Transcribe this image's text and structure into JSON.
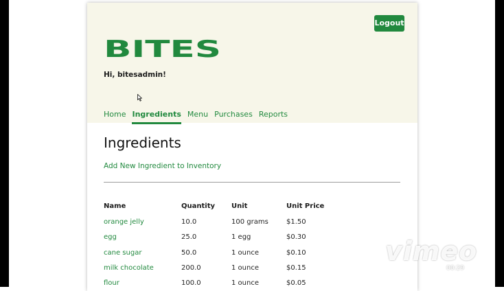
{
  "app": {
    "logout_label": "Logout",
    "logo_text": "BITES",
    "greeting": "Hi, bitesadmin!"
  },
  "nav": [
    {
      "label": "Home",
      "active": false
    },
    {
      "label": "Ingredients",
      "active": true
    },
    {
      "label": "Menu",
      "active": false
    },
    {
      "label": "Purchases",
      "active": false
    },
    {
      "label": "Reports",
      "active": false
    }
  ],
  "main": {
    "title": "Ingredients",
    "add_link": "Add New Ingredient to Inventory"
  },
  "table": {
    "columns": [
      "Name",
      "Quantity",
      "Unit",
      "Unit Price"
    ],
    "rows": [
      {
        "name": "orange jelly",
        "quantity": "10.0",
        "unit": "100 grams",
        "price": "$1.50"
      },
      {
        "name": "egg",
        "quantity": "25.0",
        "unit": "1 egg",
        "price": "$0.30"
      },
      {
        "name": "cane sugar",
        "quantity": "50.0",
        "unit": "1 ounce",
        "price": "$0.10"
      },
      {
        "name": "milk chocolate",
        "quantity": "200.0",
        "unit": "1 ounce",
        "price": "$0.15"
      },
      {
        "name": "flour",
        "quantity": "100.0",
        "unit": "1 ounce",
        "price": "$0.05"
      }
    ]
  },
  "overlay": {
    "watermark": "vimeo",
    "time": "00:29",
    "icons": [
      "pencil-icon",
      "forward-icon",
      "pause-icon",
      "stop-icon",
      "power-icon"
    ]
  },
  "colors": {
    "accent": "#21893e",
    "header_bg": "#f7f6e9"
  }
}
